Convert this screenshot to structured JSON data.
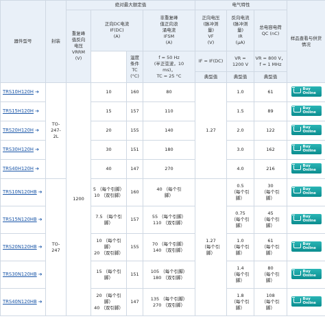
{
  "header": {
    "part_no": "器件型号",
    "package": "封装",
    "abs_max": "绝对最大额定值",
    "elec": "电气特性",
    "vrrm": [
      "重复峰",
      "值反向",
      "电压",
      "VRRM",
      "(V)"
    ],
    "ifdc": [
      "正向DC电流",
      "IF(DC)",
      "(A)"
    ],
    "ifsm": [
      "非重复峰",
      "值正向浪",
      "涌电流",
      "IFSM",
      "(A)"
    ],
    "vf": [
      "正向电压",
      "(脉冲测",
      "量)",
      "VF",
      "(V)"
    ],
    "ir": [
      "反向电流",
      "(脉冲测",
      "量)",
      "IR",
      "(μA)"
    ],
    "qc": [
      "总电容电荷",
      "QC (nC)"
    ],
    "sample": [
      "样品查看与供货",
      "情况"
    ],
    "temp": [
      "温度",
      "条件",
      "TC",
      "(°C)"
    ],
    "ifsm_cond": [
      "f = 50 Hz",
      "(半正弦波，10",
      "ms)，",
      "TC = 25 °C"
    ],
    "vf_cond": "IF = IF(DC)",
    "ir_cond": [
      "VR =",
      "1200 V"
    ],
    "qc_cond": [
      "VR = 800 V，",
      "f = 1 MHz"
    ],
    "typ1": "典型值",
    "typ2": "典型值",
    "typ3": "典型值"
  },
  "rows": [
    {
      "part": "TRS10H120H",
      "ifdc": "10",
      "tc": "160",
      "ifsm": "80",
      "ir": "1.0",
      "qc": "61"
    },
    {
      "part": "TRS15H120H",
      "ifdc": "15",
      "tc": "157",
      "ifsm": "110",
      "ir": "1.5",
      "qc": "89"
    },
    {
      "part": "TRS20H120H",
      "ifdc": "20",
      "tc": "155",
      "ifsm": "140",
      "ir": "2.0",
      "qc": "122"
    },
    {
      "part": "TRS30H120H",
      "ifdc": "30",
      "tc": "151",
      "ifsm": "180",
      "ir": "3.0",
      "qc": "162"
    },
    {
      "part": "TRS40H120H",
      "ifdc": "40",
      "tc": "147",
      "ifsm": "270",
      "ir": "4.0",
      "qc": "216"
    },
    {
      "part": "TRS10N120HB",
      "ifdc": [
        "5 （每个引脚）",
        "10 （双引脚）"
      ],
      "tc": "160",
      "ifsm": [
        "40 （每个引",
        "脚）"
      ],
      "ir": [
        "0.5",
        "（每个引",
        "脚）"
      ],
      "qc": [
        "30",
        "（每个引",
        "脚）"
      ]
    },
    {
      "part": "TRS15N120HB",
      "ifdc": [
        "7.5 （每个引",
        "脚）"
      ],
      "tc": "157",
      "ifsm": [
        "55 （每个引脚）",
        "110 （双引脚）"
      ],
      "ir": [
        "0.75",
        "（每个引",
        "脚）"
      ],
      "qc": [
        "45",
        "（每个引",
        "脚）"
      ]
    },
    {
      "part": "TRS20N120HB",
      "ifdc": [
        "10 （每个引",
        "脚）",
        "20 （双引脚）"
      ],
      "tc": "155",
      "ifsm": [
        "70 （每个引脚）",
        "140 （双引脚）"
      ],
      "ir": [
        "1.0",
        "（每个引",
        "脚）"
      ],
      "qc": [
        "61",
        "（每个引",
        "脚）"
      ]
    },
    {
      "part": "TRS30N120HB",
      "ifdc": [
        "15 （每个引",
        "脚）"
      ],
      "tc": "151",
      "ifsm": [
        "105 （每个引脚）",
        "180 （双引脚）"
      ],
      "ir": [
        "1.4",
        "（每个引",
        "脚）"
      ],
      "qc": [
        "80",
        "（每个引",
        "脚）"
      ]
    },
    {
      "part": "TRS40N120HB",
      "ifdc": [
        "20 （每个引",
        "脚）",
        "40 （双引脚）"
      ],
      "tc": "147",
      "ifsm": [
        "135 （每个引脚）",
        "270 （双引脚）"
      ],
      "ir": [
        "1.8",
        "（每个引",
        "脚）"
      ],
      "qc": [
        "108",
        "（每个引",
        "脚）"
      ]
    }
  ],
  "package1": [
    "TO-",
    "247-",
    "2L"
  ],
  "package2": [
    "TO-",
    "247"
  ],
  "vrrm_value": "1200",
  "vf1": "1.27",
  "vf2": [
    "1.27",
    "（每个引",
    "脚）"
  ],
  "buy": {
    "line1": "Buy",
    "line2": "Online"
  },
  "link_arrow": "➔",
  "colors": {
    "header_bg": "#e9f0f8",
    "link": "#1a56a8",
    "buy_button": "#0b8d8f",
    "border": "#cfd8e3"
  }
}
